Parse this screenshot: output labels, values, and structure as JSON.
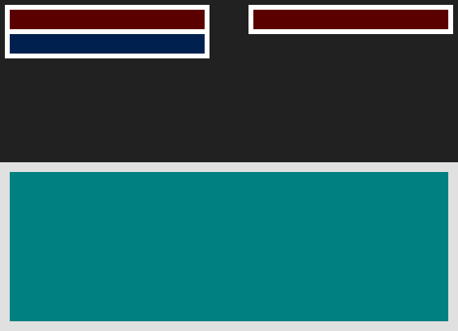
{
  "colors": {
    "top_background": "#212121",
    "bottom_background": "#e0e0e0",
    "panel_background": "#ffffff",
    "bar_dark_red": "#5a0000",
    "bar_navy": "#00214f",
    "content_teal": "#008080"
  }
}
